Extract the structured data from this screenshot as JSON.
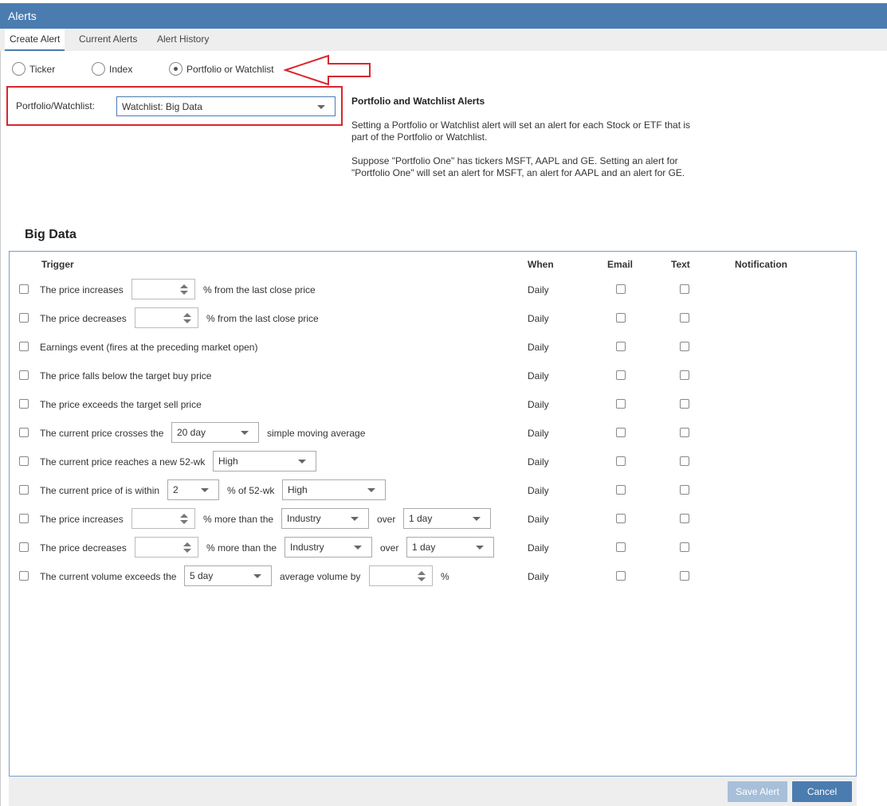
{
  "window": {
    "title": "Alerts"
  },
  "tabs": [
    {
      "label": "Create Alert",
      "active": true
    },
    {
      "label": "Current Alerts",
      "active": false
    },
    {
      "label": "Alert History",
      "active": false
    }
  ],
  "alert_type": {
    "options": [
      "Ticker",
      "Index",
      "Portfolio or Watchlist"
    ],
    "selected": "Portfolio or Watchlist"
  },
  "portfolio": {
    "label": "Portfolio/Watchlist:",
    "value": "Watchlist: Big Data"
  },
  "info": {
    "title": "Portfolio and Watchlist Alerts",
    "p1": "Setting a Portfolio or Watchlist alert will set an alert for each Stock or ETF that is part of the Portfolio or Watchlist.",
    "p2": "Suppose \"Portfolio One\" has tickers MSFT, AAPL and GE. Setting an alert for \"Portfolio One\" will set an alert for MSFT, an alert for AAPL and an alert for GE."
  },
  "section_title": "Big Data",
  "table": {
    "headers": {
      "trigger": "Trigger",
      "when": "When",
      "email": "Email",
      "text": "Text",
      "notification": "Notification"
    },
    "rows": [
      {
        "t1": "The price increases",
        "t2": "% from the last close price",
        "when": "Daily"
      },
      {
        "t1": "The price decreases",
        "t2": "% from the last close price",
        "when": "Daily"
      },
      {
        "t1": "Earnings event (fires at the preceding market open)",
        "when": "Daily"
      },
      {
        "t1": "The price falls below the target buy price",
        "when": "Daily"
      },
      {
        "t1": "The price exceeds the target sell price",
        "when": "Daily"
      },
      {
        "t1": "The current price crosses the",
        "s1": "20 day",
        "t2": "simple moving average",
        "when": "Daily"
      },
      {
        "t1": "The current price reaches a new 52-wk",
        "s1": "High",
        "when": "Daily"
      },
      {
        "t1": "The current price of is within",
        "s1": "2",
        "t2": "% of 52-wk",
        "s2": "High",
        "when": "Daily"
      },
      {
        "t1": "The price increases",
        "t2": "% more than the",
        "s1": "Industry",
        "t3": "over",
        "s2": "1 day",
        "when": "Daily"
      },
      {
        "t1": "The price decreases",
        "t2": "% more than the",
        "s1": "Industry",
        "t3": "over",
        "s2": "1 day",
        "when": "Daily"
      },
      {
        "t1": "The current volume exceeds the",
        "s1": "5 day",
        "t2": "average volume by",
        "t3": "%",
        "when": "Daily"
      }
    ]
  },
  "buttons": {
    "save": "Save Alert",
    "cancel": "Cancel"
  },
  "colors": {
    "brand": "#4a7cb0",
    "annotation": "#d9262c"
  }
}
